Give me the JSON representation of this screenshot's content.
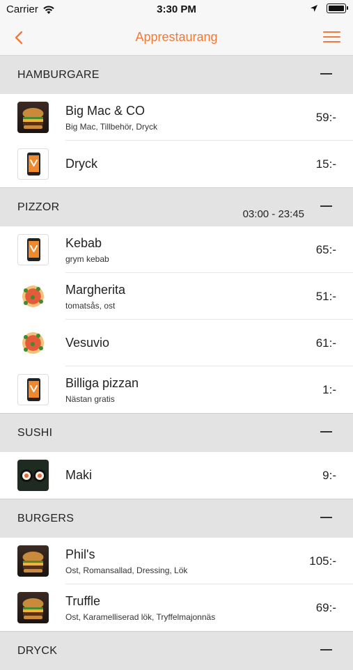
{
  "status_bar": {
    "carrier": "Carrier",
    "time": "3:30 PM"
  },
  "nav": {
    "title": "Apprestaurang",
    "back_icon": "chevron-left-icon",
    "menu_icon": "hamburger-menu-icon",
    "accent_color": "#f07a3a"
  },
  "sections": [
    {
      "title": "HAMBURGARE",
      "hours": "",
      "items": [
        {
          "name": "Big Mac & CO",
          "desc": "Big Mac, Tillbehör, Dryck",
          "price": "59:-",
          "thumb": "burger"
        },
        {
          "name": "Dryck",
          "desc": "",
          "price": "15:-",
          "thumb": "app"
        }
      ]
    },
    {
      "title": "PIZZOR",
      "hours": "03:00 - 23:45",
      "items": [
        {
          "name": "Kebab",
          "desc": "grym kebab",
          "price": "65:-",
          "thumb": "app"
        },
        {
          "name": "Margherita",
          "desc": "tomatsås, ost",
          "price": "51:-",
          "thumb": "pizza"
        },
        {
          "name": "Vesuvio",
          "desc": "",
          "price": "61:-",
          "thumb": "pizza"
        },
        {
          "name": "Billiga pizzan",
          "desc": "Nästan gratis",
          "price": "1:-",
          "thumb": "app"
        }
      ]
    },
    {
      "title": "SUSHI",
      "hours": "",
      "items": [
        {
          "name": "Maki",
          "desc": "",
          "price": "9:-",
          "thumb": "sushi"
        }
      ]
    },
    {
      "title": "BURGERS",
      "hours": "",
      "items": [
        {
          "name": "Phil's",
          "desc": "Ost, Romansallad, Dressing, Lök",
          "price": "105:-",
          "thumb": "burger"
        },
        {
          "name": "Truffle",
          "desc": "Ost, Karamelliserad lök, Tryffelmajonnäs",
          "price": "69:-",
          "thumb": "burger"
        }
      ]
    },
    {
      "title": "DRYCK",
      "hours": "",
      "items": []
    }
  ]
}
